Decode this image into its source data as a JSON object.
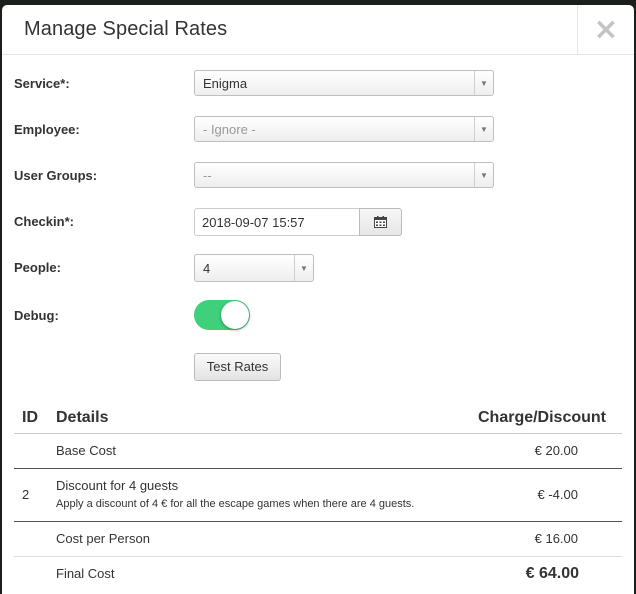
{
  "modal": {
    "title": "Manage Special Rates",
    "close_glyph": "×"
  },
  "form": {
    "service": {
      "label": "Service*:",
      "value": "Enigma"
    },
    "employee": {
      "label": "Employee:",
      "value": "- Ignore -"
    },
    "user_groups": {
      "label": "User Groups:",
      "value": "--"
    },
    "checkin": {
      "label": "Checkin*:",
      "value": "2018-09-07 15:57"
    },
    "people": {
      "label": "People:",
      "value": "4"
    },
    "debug": {
      "label": "Debug:",
      "on": true
    },
    "test_button": "Test Rates"
  },
  "table": {
    "headers": {
      "id": "ID",
      "details": "Details",
      "amount": "Charge/Discount"
    },
    "rows": [
      {
        "id": "",
        "details": "Base Cost",
        "description": "",
        "amount": "€ 20.00"
      },
      {
        "id": "2",
        "details": "Discount for 4 guests",
        "description": "Apply a discount of 4 € for all the escape games when there are 4 guests.",
        "amount": "€ -4.00"
      },
      {
        "id": "",
        "details": "Cost per Person",
        "description": "",
        "amount": "€ 16.00"
      },
      {
        "id": "",
        "details": "Final Cost",
        "description": "",
        "amount": "€ 64.00"
      }
    ]
  },
  "colors": {
    "toggle_on": "#3fd07b",
    "backdrop": "#1b1f1b"
  },
  "icons": {
    "close": "close-icon",
    "calendar": "calendar-icon",
    "caret": "chevron-down-icon"
  }
}
